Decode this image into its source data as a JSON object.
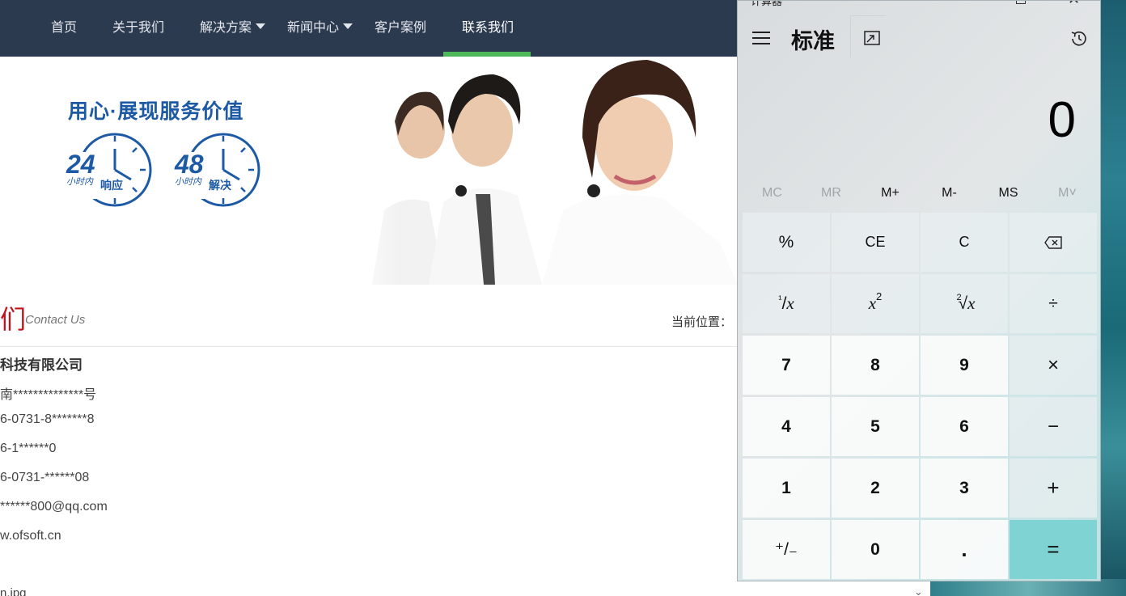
{
  "website": {
    "nav": [
      {
        "label": "首页",
        "caret": false,
        "active": false
      },
      {
        "label": "关于我们",
        "caret": false,
        "active": false
      },
      {
        "label": "解决方案",
        "caret": true,
        "active": false
      },
      {
        "label": "新闻中心",
        "caret": true,
        "active": false
      },
      {
        "label": "客户案例",
        "caret": false,
        "active": false
      },
      {
        "label": "联系我们",
        "caret": false,
        "active": true
      }
    ],
    "banner": {
      "slogan": "用心·展现服务价值",
      "clock1": {
        "hours": "24",
        "small": "小时内",
        "word": "响应"
      },
      "clock2": {
        "hours": "48",
        "small": "小时内",
        "word": "解决"
      }
    },
    "heading_cn": "们",
    "heading_en": "Contact Us",
    "breadcrumb": "当前位置：",
    "company": "科技有限公司",
    "info_lines": [
      "南**************号",
      "6-0731-8*******8",
      "6-1******0",
      "6-0731-******08",
      "******800@qq.com",
      "w.ofsoft.cn"
    ],
    "trailing": "n.jpg",
    "scroll_arrow": "⌄"
  },
  "calculator": {
    "window_title": "计算器",
    "close_glyph": "✕",
    "mode": "标准",
    "display": "0",
    "memory": [
      {
        "label": "MC",
        "enabled": false
      },
      {
        "label": "MR",
        "enabled": false
      },
      {
        "label": "M+",
        "enabled": true
      },
      {
        "label": "M-",
        "enabled": true
      },
      {
        "label": "MS",
        "enabled": true
      },
      {
        "label": "M˅",
        "enabled": false
      }
    ],
    "keys": {
      "percent": "%",
      "ce": "CE",
      "c": "C",
      "recip_num": "¹",
      "recip_slash": "/",
      "recip_x": "x",
      "sq_x": "x",
      "sq_pow": "2",
      "sqrt_idx": "2",
      "sqrt_sign": "√",
      "sqrt_x": "x",
      "divide": "÷",
      "multiply": "×",
      "minus": "−",
      "plus": "+",
      "equals": "=",
      "n7": "7",
      "n8": "8",
      "n9": "9",
      "n4": "4",
      "n5": "5",
      "n6": "6",
      "n1": "1",
      "n2": "2",
      "n3": "3",
      "negate": "⁺/₋",
      "n0": "0",
      "decimal": "."
    },
    "colors": {
      "equals": "#7fd3d3",
      "accent_bar": "#4fb85a",
      "nav_bg": "#2c3a50"
    }
  }
}
